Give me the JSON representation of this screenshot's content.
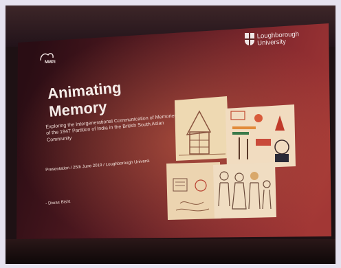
{
  "slide": {
    "logo_left": "MMPI",
    "university": {
      "line1": "Loughborough",
      "line2": "University"
    },
    "title_line1": "Animating",
    "title_line2": "Memory",
    "subtitle": "Exploring the Intergenerational Communication of Memories of the 1947 Partition of India in the British South Asian Community",
    "presentation": "Presentation / 25th June 2019 / Loughborough Universi",
    "author": "- Diwas Bisht"
  },
  "colors": {
    "slide_left": "#2a0d14",
    "slide_mid": "#6a2128",
    "slide_right": "#a23735",
    "paper": "#e9cfa4",
    "ink": "#7a4a3a"
  },
  "icons": [
    "university-shield-icon",
    "mmpi-logo-icon"
  ]
}
